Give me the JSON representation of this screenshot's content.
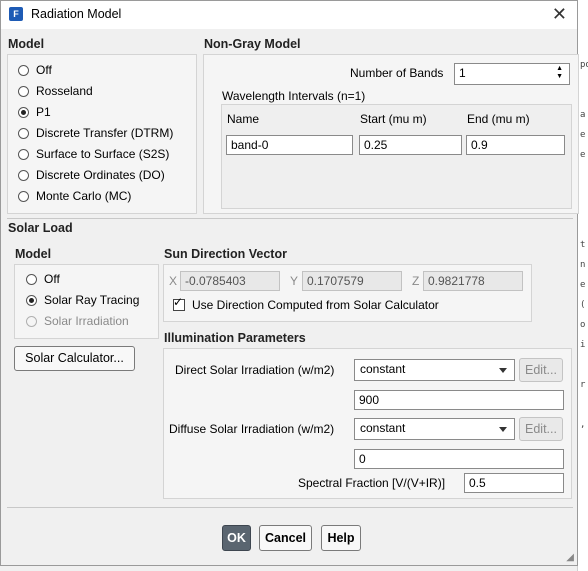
{
  "window": {
    "title": "Radiation Model",
    "icon_letter": "F",
    "close_glyph": "✕"
  },
  "model": {
    "heading": "Model",
    "options": [
      {
        "label": "Off",
        "selected": false
      },
      {
        "label": "Rosseland",
        "selected": false
      },
      {
        "label": "P1",
        "selected": true
      },
      {
        "label": "Discrete Transfer (DTRM)",
        "selected": false
      },
      {
        "label": "Surface to Surface (S2S)",
        "selected": false
      },
      {
        "label": "Discrete Ordinates (DO)",
        "selected": false
      },
      {
        "label": "Monte Carlo (MC)",
        "selected": false
      }
    ]
  },
  "nongray": {
    "heading": "Non-Gray Model",
    "bands_label": "Number of Bands",
    "bands_value": "1",
    "intervals_label": "Wavelength Intervals (n=1)",
    "columns": [
      "Name",
      "Start (mu m)",
      "End (mu m)"
    ],
    "rows": [
      {
        "name": "band-0",
        "start": "0.25",
        "end": "0.9"
      }
    ]
  },
  "solar": {
    "heading": "Solar Load",
    "model_heading": "Model",
    "options": [
      {
        "label": "Off",
        "selected": false,
        "disabled": false
      },
      {
        "label": "Solar Ray Tracing",
        "selected": true,
        "disabled": false
      },
      {
        "label": "Solar Irradiation",
        "selected": false,
        "disabled": true
      }
    ],
    "calc_button": "Solar Calculator...",
    "sun_heading": "Sun Direction Vector",
    "x_label": "X",
    "x_value": "-0.0785403",
    "y_label": "Y",
    "y_value": "0.1707579",
    "z_label": "Z",
    "z_value": "0.9821778",
    "use_calc_label": "Use Direction Computed from Solar Calculator",
    "use_calc_checked": true,
    "illum_heading": "Illumination Parameters",
    "direct_label": "Direct Solar Irradiation (w/m2)",
    "direct_method": "constant",
    "direct_value": "900",
    "diffuse_label": "Diffuse Solar Irradiation (w/m2)",
    "diffuse_method": "constant",
    "diffuse_value": "0",
    "edit_label": "Edit...",
    "spectral_label": "Spectral Fraction [V/(V+IR)]",
    "spectral_value": "0.5"
  },
  "footer": {
    "ok": "OK",
    "cancel": "Cancel",
    "help": "Help"
  },
  "colors": {
    "accent": "#1e5bb5",
    "ok_button": "#5a6570"
  }
}
